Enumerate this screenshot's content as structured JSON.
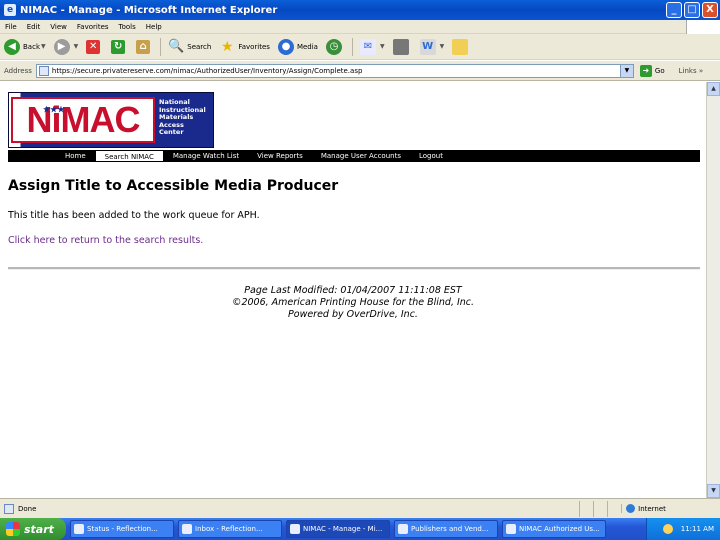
{
  "window": {
    "title": "NIMAC - Manage - Microsoft Internet Explorer",
    "minimize": "_",
    "maximize": "□",
    "close": "X"
  },
  "menu": [
    "File",
    "Edit",
    "View",
    "Favorites",
    "Tools",
    "Help"
  ],
  "toolbar": {
    "back": "Back",
    "search": "Search",
    "favorites": "Favorites",
    "media": "Media"
  },
  "address": {
    "label": "Address",
    "url": "https://secure.privatereserve.com/nimac/AuthorizedUser/Inventory/Assign/Complete.asp",
    "go": "Go",
    "links": "Links",
    "chevron": "»"
  },
  "logo": {
    "text": "NiMAC",
    "tagline": [
      "National",
      "Instructional",
      "Materials",
      "Access",
      "Center"
    ]
  },
  "nav": [
    "Home",
    "Search NIMAC",
    "Manage Watch List",
    "View Reports",
    "Manage User Accounts",
    "Logout"
  ],
  "page": {
    "heading": "Assign Title to Accessible Media Producer",
    "message": "This title has been added to the work queue for APH.",
    "return_link": "Click here to return to the search results."
  },
  "footer": {
    "modified": "Page Last Modified: 01/04/2007 11:11:08 EST",
    "copyright": "©2006, American Printing House for the Blind, Inc.",
    "powered": "Powered by OverDrive, Inc."
  },
  "status": {
    "text": "Done",
    "zone": "Internet"
  },
  "taskbar": {
    "start": "start",
    "tasks": [
      "Status - Reflection...",
      "Inbox - Reflection...",
      "NIMAC - Manage - Mi...",
      "Publishers and Vend...",
      "NIMAC Authorized Us..."
    ],
    "clock": "11:11 AM"
  }
}
